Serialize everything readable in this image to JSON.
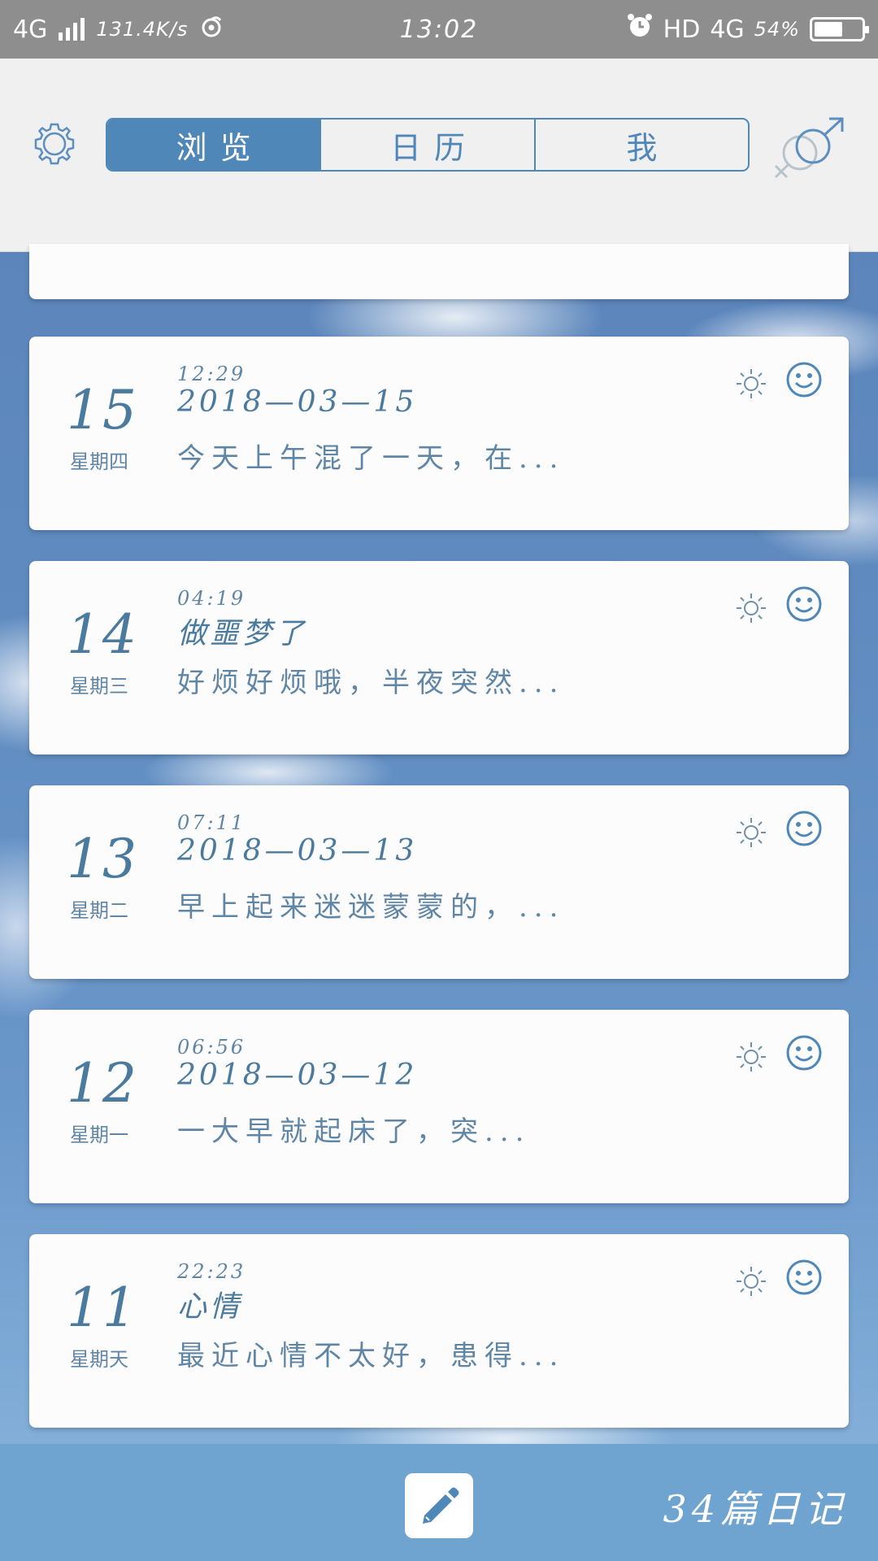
{
  "status_bar": {
    "network": "4G",
    "speed": "131.4K/s",
    "time": "13:02",
    "hd": "HD",
    "network_right": "4G",
    "battery": "54%"
  },
  "header": {
    "tabs": [
      {
        "label": "浏览",
        "active": true
      },
      {
        "label": "日历",
        "active": false
      },
      {
        "label": "我",
        "active": false
      }
    ],
    "accent_color": "#4f87b8"
  },
  "entries": [
    {
      "day": "15",
      "weekday": "星期四",
      "time": "12:29",
      "title": "2018—03—15",
      "excerpt": "今天上午混了一天，在...",
      "weather_icon": "sun-icon",
      "mood_icon": "smile-icon"
    },
    {
      "day": "14",
      "weekday": "星期三",
      "time": "04:19",
      "title": "做噩梦了",
      "excerpt": "好烦好烦哦，半夜突然...",
      "weather_icon": "sun-icon",
      "mood_icon": "smile-icon"
    },
    {
      "day": "13",
      "weekday": "星期二",
      "time": "07:11",
      "title": "2018—03—13",
      "excerpt": "早上起来迷迷蒙蒙的，...",
      "weather_icon": "sun-icon",
      "mood_icon": "smile-icon"
    },
    {
      "day": "12",
      "weekday": "星期一",
      "time": "06:56",
      "title": "2018—03—12",
      "excerpt": "一大早就起床了，突...",
      "weather_icon": "sun-icon",
      "mood_icon": "smile-icon"
    },
    {
      "day": "11",
      "weekday": "星期天",
      "time": "22:23",
      "title": "心情",
      "excerpt": "最近心情不太好，患得...",
      "weather_icon": "sun-icon",
      "mood_icon": "smile-icon"
    }
  ],
  "footer": {
    "diary_count": "34篇日记",
    "edit_icon": "pencil-icon"
  }
}
